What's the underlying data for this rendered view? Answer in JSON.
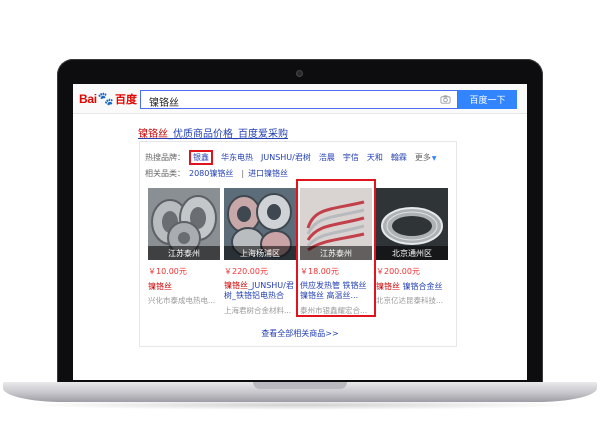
{
  "search": {
    "logo_text_a": "Bai",
    "logo_text_b": "百度",
    "query": "镍铬丝",
    "button_label": "百度一下"
  },
  "result": {
    "title_highlight": "镍铬丝",
    "title_rest": "_优质商品价格_百度爱采购"
  },
  "hot_brands": {
    "label": "热搜品牌：",
    "items": [
      "银鑫",
      "华东电热",
      "JUNSHU/君树",
      "浩晨",
      "宇信",
      "天和",
      "翰霖"
    ],
    "more": "更多"
  },
  "related": {
    "label": "相关品类：",
    "items": [
      "2080镍铬丝",
      "进口镍铬丝"
    ]
  },
  "products": [
    {
      "location": "江苏泰州",
      "price": "￥10.00元",
      "name_hl": "镍铬丝",
      "name_rest": "",
      "seller": "兴化市泰成电热电..."
    },
    {
      "location": "上海杨浦区",
      "price": "￥220.00元",
      "name_hl": "镍铬丝",
      "name_rest": "_JUNSHU/君树_铁铬铝电热合",
      "seller": "上海君树合金材料..."
    },
    {
      "location": "江苏泰州",
      "price": "￥18.00元",
      "name_hl": "",
      "name_rest": "供应发热管 铁铬丝 镍铬丝 高温丝...",
      "seller": "泰州市银鑫耀宏合..."
    },
    {
      "location": "北京通州区",
      "price": "￥200.00元",
      "name_hl": "镍铬丝",
      "name_rest": " 镍铬合金丝",
      "seller": "北京亿达昆泰科技..."
    }
  ],
  "more_link": "查看全部相关商品>>",
  "colors": {
    "accent_blue": "#3385ff",
    "link_blue": "#2440b3",
    "highlight_red": "#e0141e",
    "price_red": "#f73131"
  }
}
